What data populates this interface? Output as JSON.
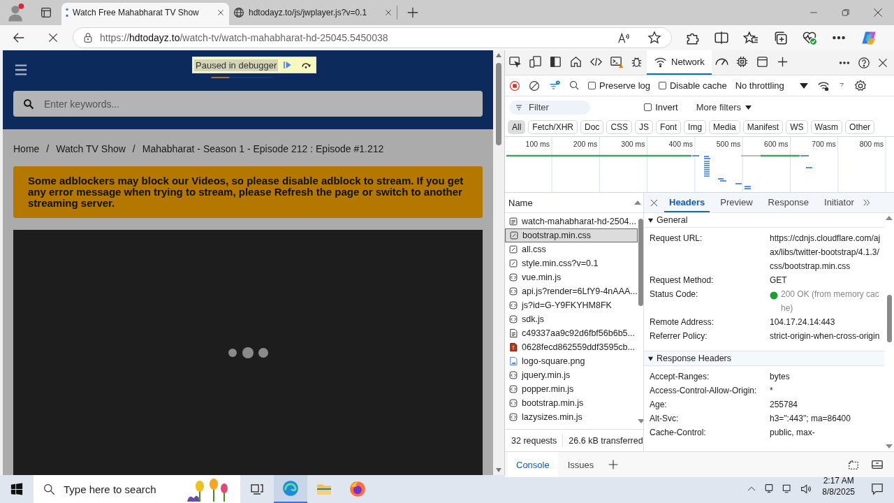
{
  "browser": {
    "tabs": [
      {
        "title": "Watch Free Mahabharat TV Show",
        "kind": "loading",
        "selected": true
      },
      {
        "title": "hdtodayz.to/js/jwplayer.js?v=0.1",
        "kind": "globe",
        "selected": false
      }
    ],
    "url": {
      "scheme": "https://",
      "host": "hdtodayz.to",
      "path": "/watch-tv/watch-mahabharat-hd-25045.5450038"
    }
  },
  "page": {
    "debugger_banner": "Paused in debugger",
    "search": {
      "placeholder": "Enter keywords..."
    },
    "breadcrumbs": [
      "Home",
      "Watch TV Show",
      "Mahabharat - Season 1 - Episode 212 : Episode #1.212"
    ],
    "breadcrumb_separators": [
      "/",
      "/"
    ],
    "notice": "Some adblockers may block our Videos, so please disable adblock to stream. If you get any error message when trying to stream, please Refresh the page or switch to another streaming server."
  },
  "devtools": {
    "panel_tabs": [
      {
        "kind": "inspect",
        "selected": false
      },
      {
        "kind": "device",
        "selected": false
      },
      {
        "kind": "dock",
        "selected": false
      },
      {
        "kind": "home",
        "selected": false
      },
      {
        "kind": "elements",
        "selected": false
      },
      {
        "kind": "console",
        "selected": false
      },
      {
        "kind": "sources",
        "selected": false
      },
      {
        "kind": "network",
        "label": "Network",
        "selected": true
      },
      {
        "kind": "performance",
        "selected": false
      },
      {
        "kind": "memory",
        "selected": false
      },
      {
        "kind": "application",
        "selected": false
      },
      {
        "kind": "add",
        "selected": false
      }
    ],
    "network_toolbar": {
      "preserve_log": {
        "label": "Preserve log",
        "checked": false
      },
      "disable_cache": {
        "label": "Disable cache",
        "checked": false
      },
      "throttling": "No throttling"
    },
    "filter": {
      "placeholder": "Filter",
      "invert": {
        "label": "Invert",
        "checked": false
      },
      "more_filters": "More filters"
    },
    "type_filters": [
      {
        "label": "All",
        "selected": true
      },
      {
        "label": "Fetch/XHR",
        "selected": false
      },
      {
        "label": "Doc",
        "selected": false
      },
      {
        "label": "CSS",
        "selected": false
      },
      {
        "label": "JS",
        "selected": false
      },
      {
        "label": "Font",
        "selected": false
      },
      {
        "label": "Img",
        "selected": false
      },
      {
        "label": "Media",
        "selected": false
      },
      {
        "label": "Manifest",
        "selected": false
      },
      {
        "label": "WS",
        "selected": false
      },
      {
        "label": "Wasm",
        "selected": false
      },
      {
        "label": "Other",
        "selected": false
      }
    ],
    "timeline_ticks": [
      "100 ms",
      "200 ms",
      "300 ms",
      "400 ms",
      "500 ms",
      "600 ms",
      "700 ms",
      "800 ms"
    ],
    "requests_header": "Name",
    "requests": [
      {
        "name": "watch-mahabharat-hd-2504...",
        "kind": "document",
        "selected": false
      },
      {
        "name": "bootstrap.min.css",
        "kind": "stylesheet",
        "selected": true
      },
      {
        "name": "all.css",
        "kind": "stylesheet",
        "selected": false
      },
      {
        "name": "style.min.css?v=0.1",
        "kind": "stylesheet",
        "selected": false
      },
      {
        "name": "vue.min.js",
        "kind": "script",
        "selected": false
      },
      {
        "name": "api.js?render=6LfY9-4nAAA...",
        "kind": "script",
        "selected": false
      },
      {
        "name": "js?id=G-Y9FKYHM8FK",
        "kind": "script",
        "selected": false
      },
      {
        "name": "sdk.js",
        "kind": "script",
        "selected": false
      },
      {
        "name": "c49337aa9c92d6fbf56b6b5...",
        "kind": "file",
        "selected": false
      },
      {
        "name": "0628fecd862559ddf3595cb...",
        "kind": "font",
        "selected": false
      },
      {
        "name": "logo-square.png",
        "kind": "image",
        "selected": false
      },
      {
        "name": "jquery.min.js",
        "kind": "script",
        "selected": false
      },
      {
        "name": "popper.min.js",
        "kind": "script",
        "selected": false
      },
      {
        "name": "bootstrap.min.js",
        "kind": "script",
        "selected": false
      },
      {
        "name": "lazysizes.min.js",
        "kind": "script",
        "selected": false
      }
    ],
    "summary": {
      "requests": "32 requests",
      "transferred": "26.6 kB transferred"
    },
    "detail_tabs": [
      {
        "label": "Headers",
        "selected": true
      },
      {
        "label": "Preview",
        "selected": false
      },
      {
        "label": "Response",
        "selected": false
      },
      {
        "label": "Initiator",
        "selected": false
      }
    ],
    "sections": [
      {
        "title": "General",
        "expanded": true,
        "rows": [
          {
            "name": "Request URL:",
            "value": "https://cdnjs.cloudflare.com/ajax/libs/twitter-bootstrap/4.1.3/css/bootstrap.min.css"
          },
          {
            "name": "Request Method:",
            "value": "GET"
          },
          {
            "name": "Status Code:",
            "value": "200 OK (from memory cache)",
            "kind": "status"
          },
          {
            "name": "Remote Address:",
            "value": "104.17.24.14:443"
          },
          {
            "name": "Referrer Policy:",
            "value": "strict-origin-when-cross-origin"
          }
        ]
      },
      {
        "title": "Response Headers",
        "expanded": true,
        "rows": [
          {
            "name": "Accept-Ranges:",
            "value": "bytes"
          },
          {
            "name": "Access-Control-Allow-Origin:",
            "value": "*"
          },
          {
            "name": "Age:",
            "value": "255784"
          },
          {
            "name": "Alt-Svc:",
            "value": "h3=\":443\"; ma=86400"
          },
          {
            "name": "Cache-Control:",
            "value": "public, max-"
          }
        ]
      }
    ],
    "drawer_tabs": [
      {
        "label": "Console",
        "selected": true
      },
      {
        "label": "Issues",
        "selected": false
      }
    ]
  },
  "taskbar": {
    "search_placeholder": "Type here to search",
    "time": "2:17 AM",
    "date": "8/8/2025"
  }
}
